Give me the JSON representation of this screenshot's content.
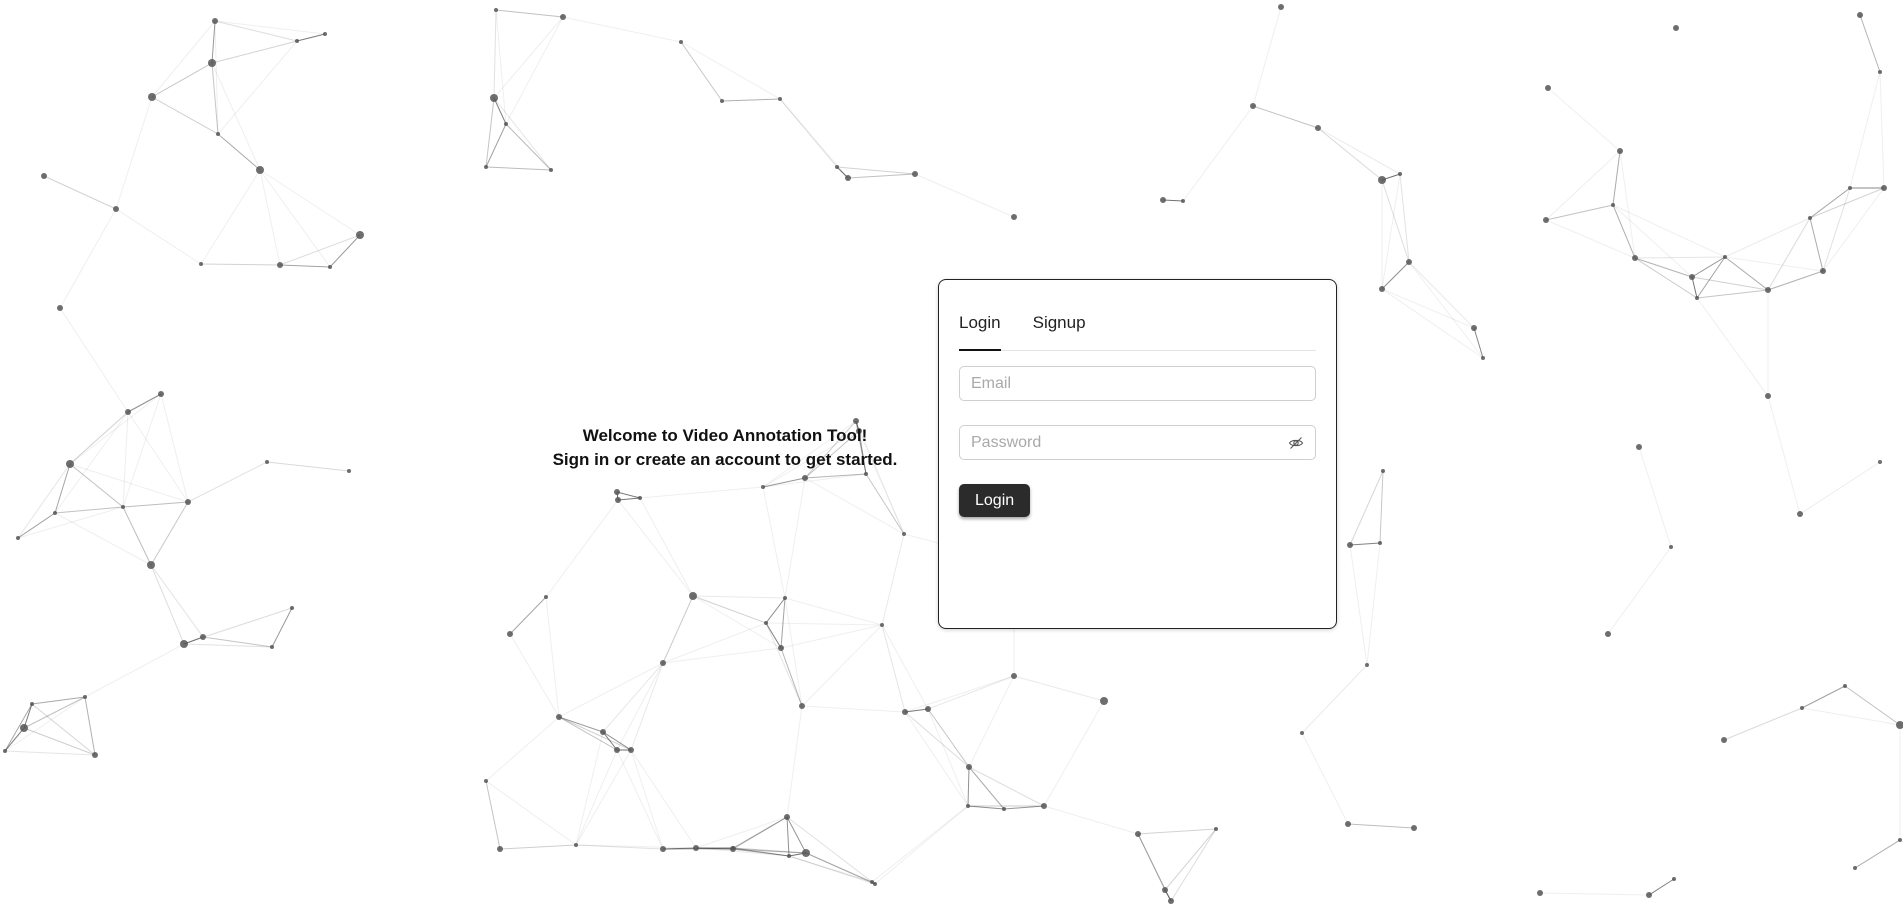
{
  "welcome": {
    "line1": "Welcome to Video Annotation Tool!",
    "line2": "Sign in or create an account to get started."
  },
  "auth": {
    "tabs": [
      {
        "label": "Login",
        "active": true
      },
      {
        "label": "Signup",
        "active": false
      }
    ],
    "email_placeholder": "Email",
    "email_value": "",
    "password_placeholder": "Password",
    "password_value": "",
    "password_toggle_icon": "eye-slash-icon",
    "submit_label": "Login"
  },
  "colors": {
    "node": "#555555",
    "edge": "#333333",
    "button_bg": "#2b2b2b",
    "background": "#ffffff"
  }
}
